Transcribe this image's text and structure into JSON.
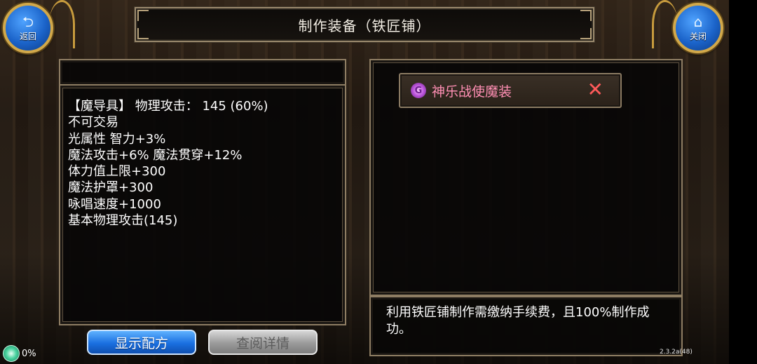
{
  "header": {
    "title": "制作装备（铁匠铺）"
  },
  "nav": {
    "back_label": "返回",
    "close_label": "关闭"
  },
  "item_stats": {
    "lines": [
      "【魔导具】 物理攻击： 145 (60%)",
      "不可交易",
      "光属性 智力+3%",
      "魔法攻击+6% 魔法贯穿+12%",
      "体力值上限+300",
      "魔法护罩+300",
      "咏唱速度+1000",
      "基本物理攻击(145)"
    ]
  },
  "selection": {
    "item_name": "神乐战使魔装",
    "close_glyph": "✕"
  },
  "notice": {
    "text": "利用铁匠铺制作需缴纳手续费，且100%制作成功。"
  },
  "buttons": {
    "show_recipe": "显示配方",
    "view_details": "查阅详情"
  },
  "status": {
    "percent": "0%",
    "version": "2.3.2a(48)"
  },
  "colors": {
    "panel_border": "#8e7d63",
    "item_name": "#ff8fb4",
    "close_x": "#ff5a5a",
    "primary_button": "#1a6fe0",
    "disabled_button": "#9a9a9a"
  }
}
